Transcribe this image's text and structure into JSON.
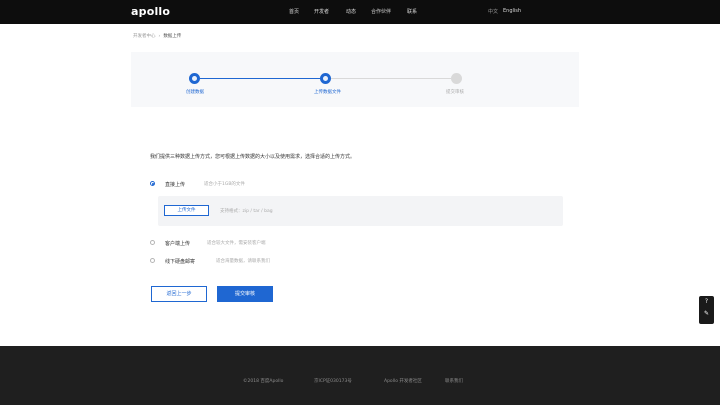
{
  "colors": {
    "accent": "#1f67d2",
    "nav_bg": "#0d0d0d",
    "footer_bg": "#1f1f1f",
    "panel_bg": "#f3f4f6"
  },
  "nav": {
    "logo": "apollo",
    "items": [
      "首页",
      "开发者",
      "动态",
      "合作伙伴",
      "联系"
    ],
    "lang_cn": "中文",
    "lang_en": "English"
  },
  "breadcrumb": {
    "parent": "开发者中心",
    "current": "数据上传"
  },
  "steps": [
    {
      "label": "创建数据",
      "state": "done"
    },
    {
      "label": "上传数据文件",
      "state": "active"
    },
    {
      "label": "提交审核",
      "state": "pending"
    }
  ],
  "intro": "我们提供三种数据上传方式，您可根据上传数据的大小以及使用需求，选择合适的上传方式。",
  "options": [
    {
      "label": "直接上传",
      "hint": "适合小于1GB的文件",
      "checked": true
    },
    {
      "label": "客户端上传",
      "hint": "适合较大文件，需安装客户端",
      "checked": false
    },
    {
      "label": "线下硬盘邮寄",
      "hint": "适合海量数据，请联系我们",
      "checked": false
    }
  ],
  "upload": {
    "button": "上传文件",
    "hint": "支持格式：zip / tar / bag"
  },
  "actions": {
    "prev": "返回上一步",
    "next": "提交审核"
  },
  "float_widget": {
    "icon1": "help-icon",
    "icon2": "feedback-icon"
  },
  "footer": {
    "links": [
      "©2018 百度Apollo",
      "京ICP证030173号",
      "Apollo 开发者社区",
      "联系我们"
    ]
  }
}
